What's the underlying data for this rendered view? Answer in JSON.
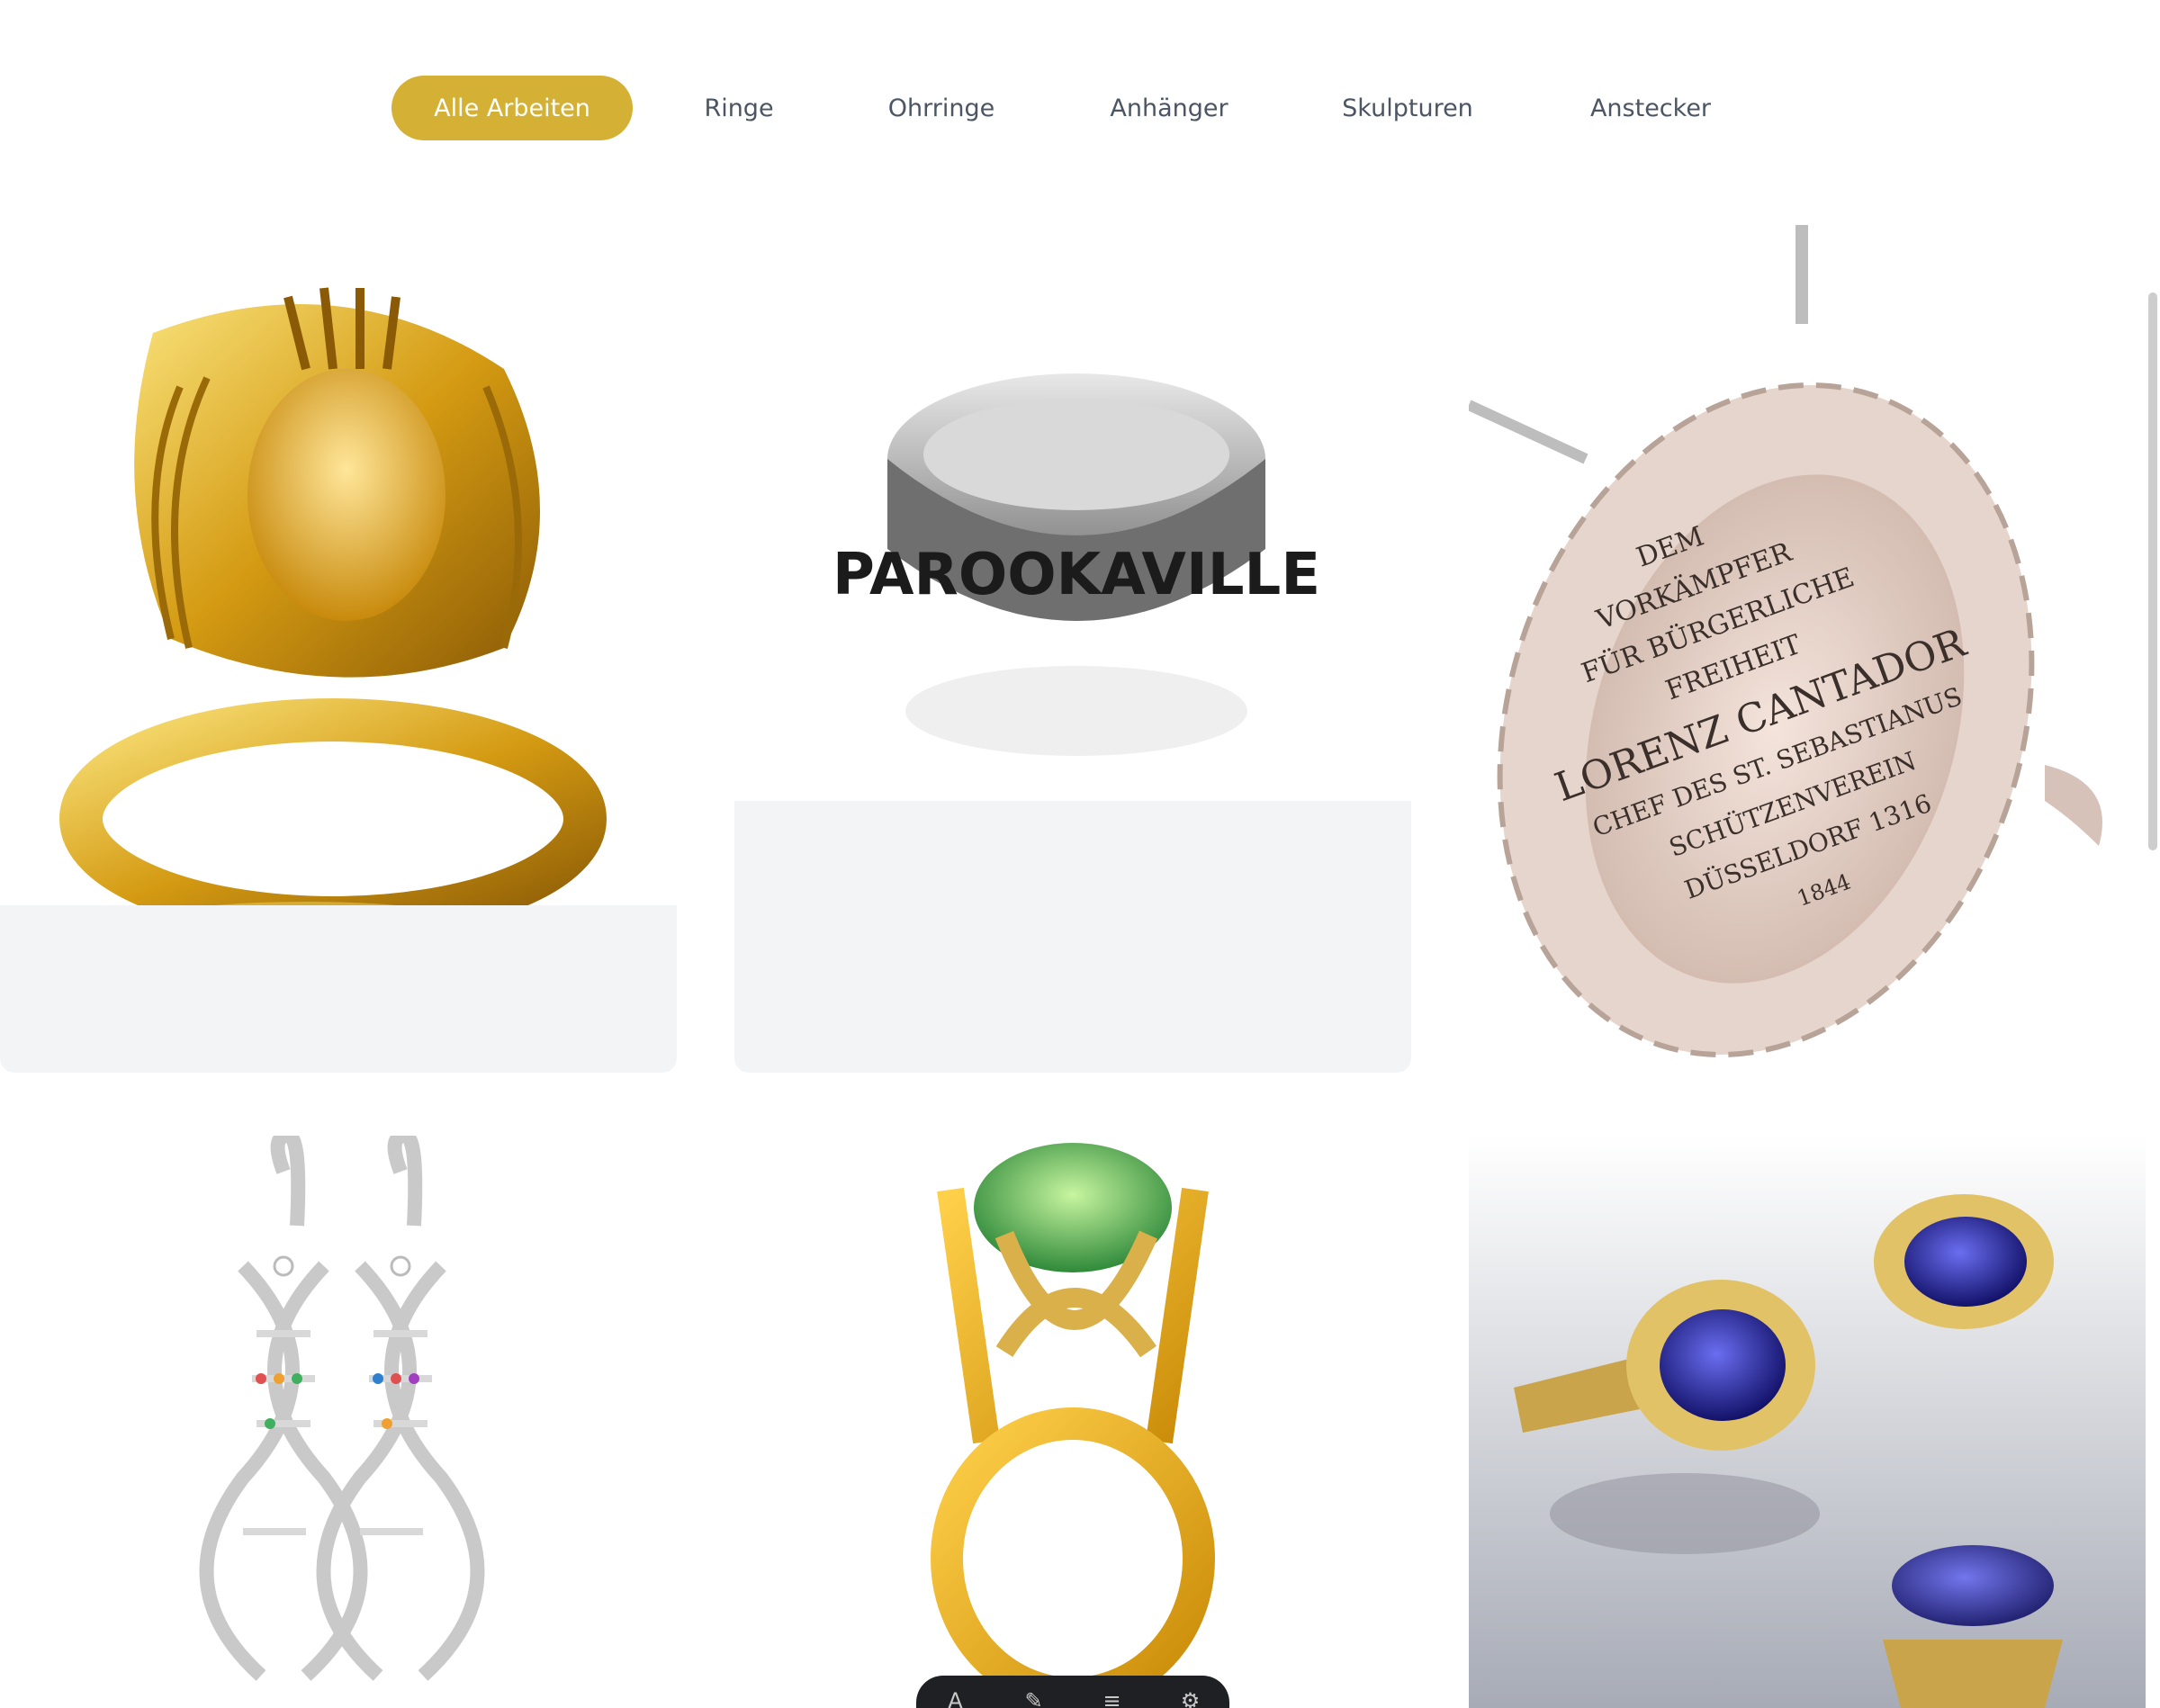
{
  "filters": {
    "items": [
      {
        "label": "Alle Arbeiten",
        "active": true
      },
      {
        "label": "Ringe",
        "active": false
      },
      {
        "label": "Ohrringe",
        "active": false
      },
      {
        "label": "Anhänger",
        "active": false
      },
      {
        "label": "Skulpturen",
        "active": false
      },
      {
        "label": "Anstecker",
        "active": false
      }
    ]
  },
  "gallery": {
    "items": [
      {
        "image": "gold-goddess-ring"
      },
      {
        "image": "silver-parookaville-ring",
        "engraving": "PAROOKAVILLE"
      },
      {
        "image": "silver-laurel-medallion",
        "engraving": [
          "DEM",
          "VORKÄMPFER",
          "FÜR BÜRGERLICHE",
          "FREIHEIT",
          "LORENZ CANTADOR",
          "CHEF DES ST. SEBASTIANUS",
          "SCHÜTZENVEREIN",
          "DÜSSELDORF 1316",
          "1844"
        ]
      },
      {
        "image": "dna-helix-earrings"
      },
      {
        "image": "green-tourmaline-gold-ring"
      },
      {
        "image": "sapphire-diamond-rings"
      }
    ]
  },
  "toolbar": {
    "icons": [
      "text-icon",
      "pen-icon",
      "list-icon",
      "settings-icon"
    ]
  },
  "colors": {
    "accent": "#d4b034",
    "tab_text": "#4b5563",
    "card_info_bg": "#f3f4f6"
  }
}
